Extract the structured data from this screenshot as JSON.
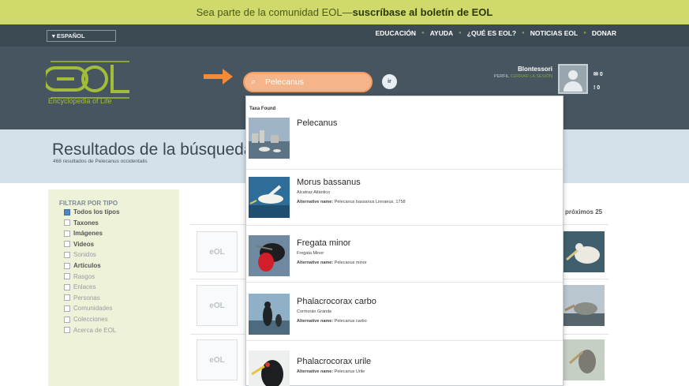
{
  "promo": {
    "text": "Sea parte de la comunidad EOL—",
    "bold": "suscríbase al boletín de EOL"
  },
  "topnav": {
    "language": "▾ ESPAÑOL",
    "links": [
      "EDUCACIÓN",
      "AYUDA",
      "¿QUÉ ES EOL?",
      "NOTICIAS EOL",
      "DONAR"
    ]
  },
  "header": {
    "logo_text": "Encyclopedia of Life",
    "search_value": "Pelecanus",
    "search_button": "ir",
    "user_name": "Blontessori",
    "profile_label": "PERFIL",
    "logout_label": "CERRAR LA SESIÓN",
    "messages_count": "0",
    "alerts_count": "0"
  },
  "title": {
    "heading": "Resultados de la búsqueda",
    "subtitle": "468 resultados de Pelecanus occidentalis"
  },
  "filters": {
    "title": "FILTRAR POR TIPO",
    "items": [
      {
        "label": "Todos los tipos",
        "checked": true,
        "dim": false
      },
      {
        "label": "Taxones",
        "checked": false,
        "dim": false
      },
      {
        "label": "Imágenes",
        "checked": false,
        "dim": false
      },
      {
        "label": "Videos",
        "checked": false,
        "dim": false
      },
      {
        "label": "Sonidos",
        "checked": false,
        "dim": true
      },
      {
        "label": "Artículos",
        "checked": false,
        "dim": false
      },
      {
        "label": "Rasgos",
        "checked": false,
        "dim": true
      },
      {
        "label": "Enlaces",
        "checked": false,
        "dim": true
      },
      {
        "label": "Personas",
        "checked": false,
        "dim": true
      },
      {
        "label": "Comunidades",
        "checked": false,
        "dim": true
      },
      {
        "label": "Colecciones",
        "checked": false,
        "dim": true
      },
      {
        "label": "Acerca de EOL",
        "checked": false,
        "dim": true
      }
    ]
  },
  "results": {
    "next_label": "próximos 25",
    "placeholder_logo": "eOL"
  },
  "dropdown": {
    "section_title": "Taxa Found",
    "items": [
      {
        "name": "Pelecanus",
        "common": "",
        "alt": ""
      },
      {
        "name": "Morus bassanus",
        "common": "Alcatraz Atlántico",
        "alt": "Pelecanus bassanus Linnaeus, 1758"
      },
      {
        "name": "Fregata minor",
        "common": "Fregata Minor",
        "alt": "Pelecanus minor"
      },
      {
        "name": "Phalacrocorax carbo",
        "common": "Cormorán Grande",
        "alt": "Pelecanus carbo"
      },
      {
        "name": "Phalacrocorax urile",
        "common": "",
        "alt": "Pelecanus Urile"
      }
    ],
    "alt_prefix": "Alternative name:"
  },
  "colors": {
    "accent_green": "#d0da6c",
    "nav_dark": "#3c4a54",
    "search_orange": "#f6b48a",
    "arrow_orange": "#f28c3a"
  }
}
